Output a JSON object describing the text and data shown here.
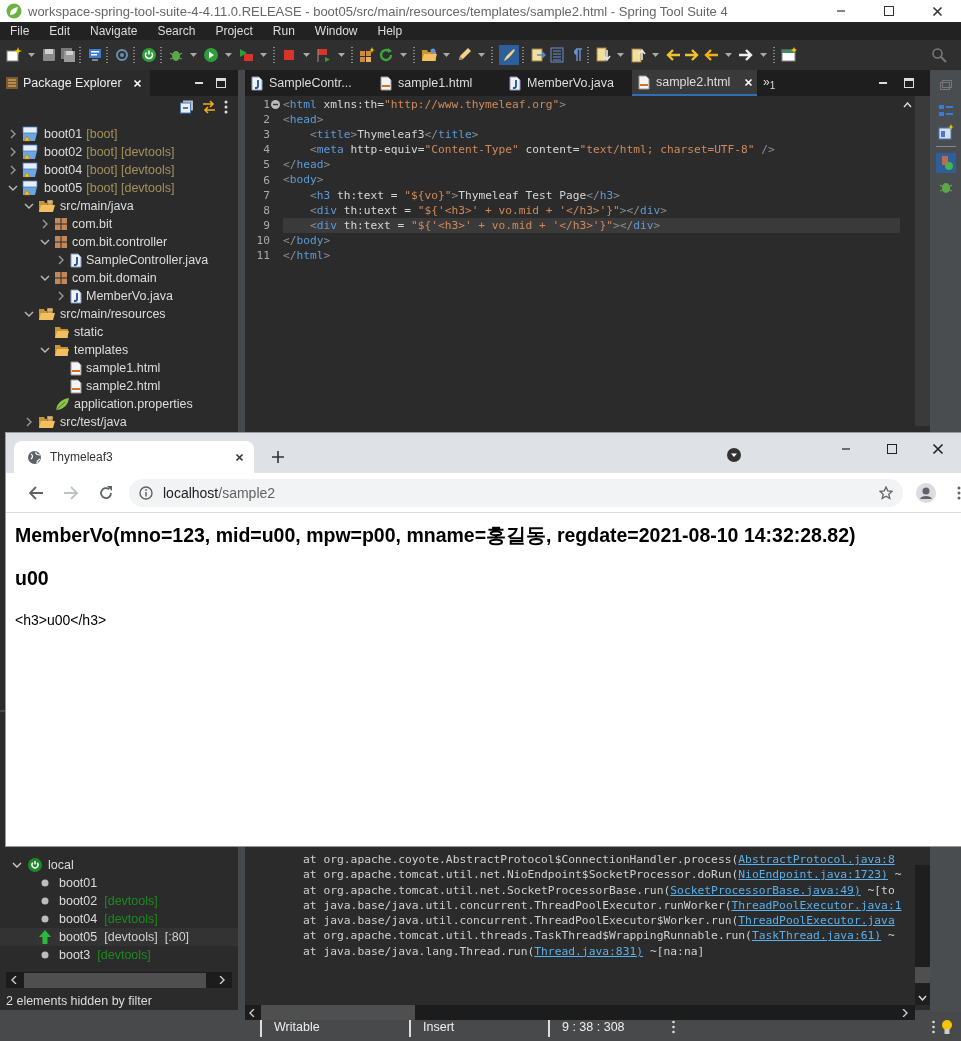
{
  "window": {
    "title": "workspace-spring-tool-suite-4-4.11.0.RELEASE - boot05/src/main/resources/templates/sample2.html - Spring Tool Suite 4"
  },
  "menu": [
    "File",
    "Edit",
    "Navigate",
    "Search",
    "Project",
    "Run",
    "Window",
    "Help"
  ],
  "package_explorer": {
    "title": "Package Explorer",
    "tree": [
      {
        "label": "boot01",
        "decoration": "[boot]",
        "kind": "project",
        "expanded": false
      },
      {
        "label": "boot02",
        "decoration": "[boot] [devtools]",
        "kind": "project",
        "expanded": false
      },
      {
        "label": "boot04",
        "decoration": "[boot] [devtools]",
        "kind": "project",
        "expanded": false
      },
      {
        "label": "boot05",
        "decoration": "[boot] [devtools]",
        "kind": "project",
        "expanded": true,
        "children": [
          {
            "label": "src/main/java",
            "kind": "source-folder",
            "expanded": true,
            "children": [
              {
                "label": "com.bit",
                "kind": "package",
                "expanded": false
              },
              {
                "label": "com.bit.controller",
                "kind": "package",
                "expanded": true,
                "children": [
                  {
                    "label": "SampleController.java",
                    "kind": "java",
                    "expanded": false
                  }
                ]
              },
              {
                "label": "com.bit.domain",
                "kind": "package",
                "expanded": true,
                "children": [
                  {
                    "label": "MemberVo.java",
                    "kind": "java",
                    "expanded": false
                  }
                ]
              }
            ]
          },
          {
            "label": "src/main/resources",
            "kind": "source-folder",
            "expanded": true,
            "children": [
              {
                "label": "static",
                "kind": "folder"
              },
              {
                "label": "templates",
                "kind": "folder",
                "expanded": true,
                "children": [
                  {
                    "label": "sample1.html",
                    "kind": "html"
                  },
                  {
                    "label": "sample2.html",
                    "kind": "html"
                  }
                ]
              },
              {
                "label": "application.properties",
                "kind": "properties"
              }
            ]
          },
          {
            "label": "src/test/java",
            "kind": "source-folder",
            "expanded": false
          }
        ]
      }
    ]
  },
  "editor": {
    "tabs": [
      {
        "label": "SampleContr...",
        "kind": "java",
        "selected": false
      },
      {
        "label": "sample1.html",
        "kind": "html",
        "selected": false
      },
      {
        "label": "MemberVo.java",
        "kind": "java",
        "selected": false
      },
      {
        "label": "sample2.html",
        "kind": "html",
        "selected": true
      }
    ],
    "overflow": "»$_{1}$",
    "lines": [
      {
        "number": "1",
        "fold_marker": true,
        "current": false,
        "tokens": [
          {
            "kind": "punct",
            "text": "<"
          },
          {
            "kind": "tag",
            "text": "html"
          },
          {
            "kind": "attr",
            "text": " xmlns:th"
          },
          {
            "kind": "text",
            "text": "="
          },
          {
            "kind": "string",
            "text": "\"http://www.thymeleaf.org\""
          },
          {
            "kind": "punct",
            "text": ">"
          }
        ]
      },
      {
        "number": "2",
        "fold_marker": false,
        "current": false,
        "tokens": [
          {
            "kind": "punct",
            "text": "<"
          },
          {
            "kind": "tag",
            "text": "head"
          },
          {
            "kind": "punct",
            "text": ">"
          }
        ]
      },
      {
        "number": "3",
        "fold_marker": false,
        "current": false,
        "tokens": [
          {
            "kind": "punct",
            "text": "    <"
          },
          {
            "kind": "tag",
            "text": "title"
          },
          {
            "kind": "punct",
            "text": ">"
          },
          {
            "kind": "text",
            "text": "Thymeleaf3"
          },
          {
            "kind": "punct",
            "text": "</"
          },
          {
            "kind": "tag",
            "text": "title"
          },
          {
            "kind": "punct",
            "text": ">"
          }
        ]
      },
      {
        "number": "4",
        "fold_marker": false,
        "current": false,
        "tokens": [
          {
            "kind": "punct",
            "text": "    <"
          },
          {
            "kind": "tag",
            "text": "meta"
          },
          {
            "kind": "attr",
            "text": " http-equiv"
          },
          {
            "kind": "text",
            "text": "="
          },
          {
            "kind": "string",
            "text": "\"Content-Type\""
          },
          {
            "kind": "attr",
            "text": " content"
          },
          {
            "kind": "text",
            "text": "="
          },
          {
            "kind": "string",
            "text": "\"text/html; charset=UTF-8\""
          },
          {
            "kind": "punct",
            "text": " />"
          }
        ]
      },
      {
        "number": "5",
        "fold_marker": false,
        "current": false,
        "tokens": [
          {
            "kind": "punct",
            "text": "</"
          },
          {
            "kind": "tag",
            "text": "head"
          },
          {
            "kind": "punct",
            "text": ">"
          }
        ]
      },
      {
        "number": "6",
        "fold_marker": false,
        "current": false,
        "tokens": [
          {
            "kind": "punct",
            "text": "<"
          },
          {
            "kind": "tag",
            "text": "body"
          },
          {
            "kind": "punct",
            "text": ">"
          }
        ]
      },
      {
        "number": "7",
        "fold_marker": false,
        "current": false,
        "tokens": [
          {
            "kind": "punct",
            "text": "    <"
          },
          {
            "kind": "tag",
            "text": "h3"
          },
          {
            "kind": "attr",
            "text": " th:text"
          },
          {
            "kind": "text",
            "text": " = "
          },
          {
            "kind": "string",
            "text": "\"${vo}\""
          },
          {
            "kind": "punct",
            "text": ">"
          },
          {
            "kind": "text",
            "text": "Thymeleaf Test Page"
          },
          {
            "kind": "punct",
            "text": "</"
          },
          {
            "kind": "tag",
            "text": "h3"
          },
          {
            "kind": "punct",
            "text": ">"
          }
        ]
      },
      {
        "number": "8",
        "fold_marker": false,
        "current": false,
        "tokens": [
          {
            "kind": "punct",
            "text": "    <"
          },
          {
            "kind": "tag",
            "text": "div"
          },
          {
            "kind": "attr",
            "text": " th:utext"
          },
          {
            "kind": "text",
            "text": " = "
          },
          {
            "kind": "string",
            "text": "\"${'<h3>' + vo.mid + '</h3>'}\""
          },
          {
            "kind": "punct",
            "text": ">"
          },
          {
            "kind": "punct",
            "text": "</"
          },
          {
            "kind": "tag",
            "text": "div"
          },
          {
            "kind": "punct",
            "text": ">"
          }
        ]
      },
      {
        "number": "9",
        "fold_marker": false,
        "current": true,
        "tokens": [
          {
            "kind": "punct",
            "text": "    <"
          },
          {
            "kind": "tag",
            "text": "div"
          },
          {
            "kind": "attr",
            "text": " th:text"
          },
          {
            "kind": "text",
            "text": " = "
          },
          {
            "kind": "string",
            "text": "\"${'<h3>' + vo.mid + '</h3>'}\""
          },
          {
            "kind": "punct",
            "text": ">"
          },
          {
            "kind": "punct",
            "text": "</"
          },
          {
            "kind": "tag",
            "text": "div"
          },
          {
            "kind": "punct",
            "text": ">"
          }
        ]
      },
      {
        "number": "10",
        "fold_marker": false,
        "current": false,
        "tokens": [
          {
            "kind": "punct",
            "text": "</"
          },
          {
            "kind": "tag",
            "text": "body"
          },
          {
            "kind": "punct",
            "text": ">"
          }
        ]
      },
      {
        "number": "11",
        "fold_marker": false,
        "current": false,
        "tokens": [
          {
            "kind": "punct",
            "text": "</"
          },
          {
            "kind": "tag",
            "text": "html"
          },
          {
            "kind": "punct",
            "text": ">"
          }
        ]
      }
    ]
  },
  "boot_dashboard": {
    "tree": {
      "label": "local",
      "expanded": true,
      "children": [
        {
          "name": "boot01",
          "running": false
        },
        {
          "name": "boot02",
          "tags": [
            "[devtools]"
          ],
          "running": false
        },
        {
          "name": "boot04",
          "tags": [
            "[devtools]"
          ],
          "running": false
        },
        {
          "name": "boot05",
          "tags": [
            "[devtools]",
            "[:80]"
          ],
          "running": true
        },
        {
          "name": "boot3",
          "tags": [
            "[devtools]"
          ],
          "running": false
        }
      ]
    },
    "filter_note": "2 elements hidden by filter"
  },
  "console": {
    "lines": [
      {
        "text": "at org.apache.coyote.AbstractProtocol$ConnectionHandler.process(",
        "link": "AbstractProtocol.java:8"
      },
      {
        "text": "at org.apache.tomcat.util.net.NioEndpoint$SocketProcessor.doRun(",
        "link": "NioEndpoint.java:1723)",
        "rest": " ~"
      },
      {
        "text": "at org.apache.tomcat.util.net.SocketProcessorBase.run(",
        "link": "SocketProcessorBase.java:49)",
        "rest": " ~[to"
      },
      {
        "text": "at java.base/java.util.concurrent.ThreadPoolExecutor.runWorker(",
        "link": "ThreadPoolExecutor.java:1"
      },
      {
        "text": "at java.base/java.util.concurrent.ThreadPoolExecutor$Worker.run(",
        "link": "ThreadPoolExecutor.java"
      },
      {
        "text": "at org.apache.tomcat.util.threads.TaskThread$WrappingRunnable.run(",
        "link": "TaskThread.java:61)",
        "rest": " ~"
      },
      {
        "text": "at java.base/java.lang.Thread.run(",
        "link": "Thread.java:831)",
        "rest": " ~[na:na]"
      }
    ]
  },
  "status_bar": [
    "Writable",
    "Insert",
    "9 : 38 : 308"
  ],
  "browser": {
    "tab": {
      "title": "Thymeleaf3"
    },
    "nav": [
      {
        "kind": "back",
        "disabled": false
      },
      {
        "kind": "forward",
        "disabled": true
      },
      {
        "kind": "reload",
        "disabled": false
      }
    ],
    "url": {
      "host": "localhost",
      "path": "/sample2"
    },
    "content": [
      {
        "kind": "heading",
        "text": "MemberVo(mno=123, mid=u00, mpw=p00, mname=홍길동, regdate=2021-08-10 14:32:28.82)"
      },
      {
        "kind": "heading",
        "text": "u00"
      },
      {
        "kind": "text",
        "text": "<h3>u00</h3>"
      }
    ]
  }
}
